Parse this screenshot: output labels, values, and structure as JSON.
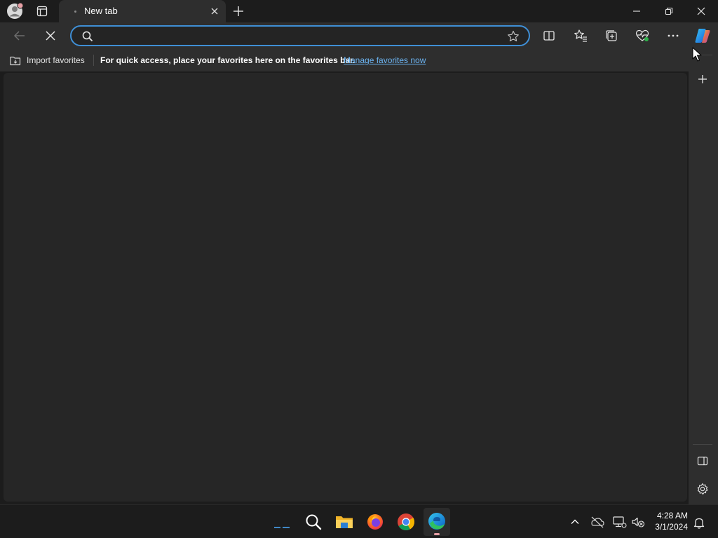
{
  "window": {
    "tab": {
      "title": "New tab"
    },
    "new_tab_symbol": "+"
  },
  "toolbar": {
    "address": {
      "value": "",
      "placeholder": ""
    }
  },
  "favorites_bar": {
    "import_label": "Import favorites",
    "message": "For quick access, place your favorites here on the favorites bar.",
    "manage_link": "Manage favorites now"
  },
  "taskbar": {
    "apps": [
      "widgets-icon",
      "search-icon",
      "file-explorer-icon",
      "firefox-icon",
      "chrome-icon",
      "edge-icon"
    ],
    "time": "4:28 AM",
    "date": "3/1/2024"
  },
  "colors": {
    "accent": "#3f8fd6",
    "link": "#6cb4f2",
    "chrome_bg": "#2e2e2e",
    "window_bg": "#1c1c1c",
    "content_bg": "#262626"
  }
}
